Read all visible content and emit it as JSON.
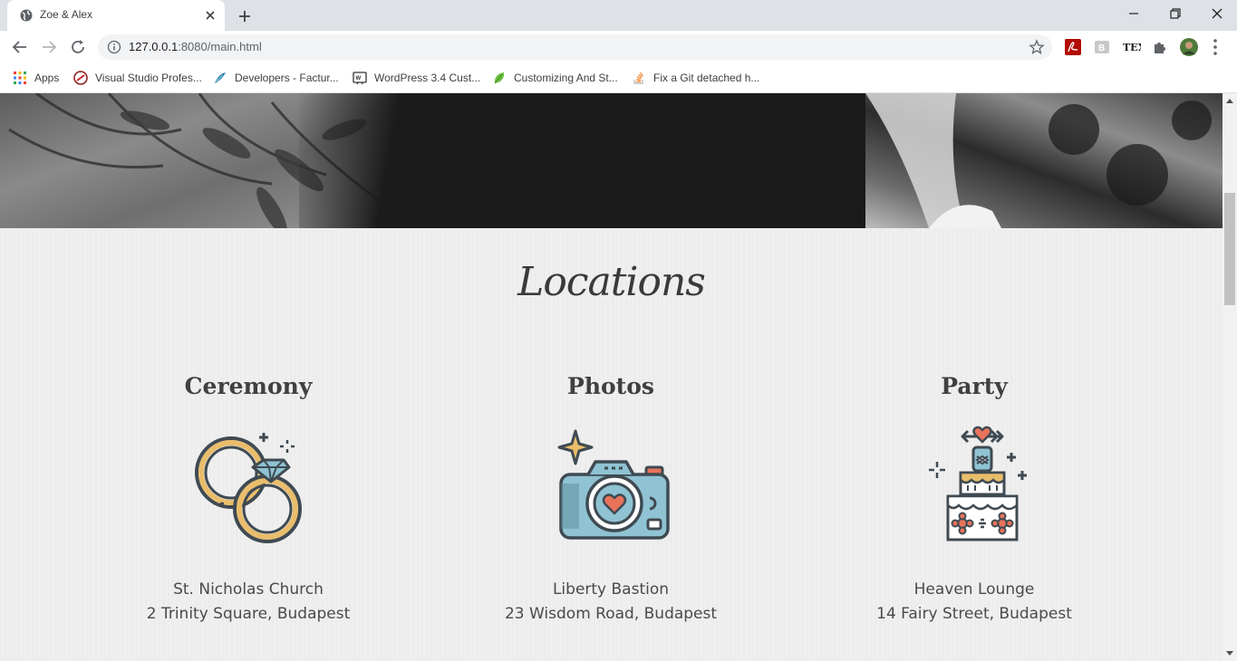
{
  "browser": {
    "tab_title": "Zoe & Alex",
    "url_host": "127.0.0.1",
    "url_rest": ":8080/main.html",
    "bookmarks": [
      {
        "label": "Apps",
        "icon": "apps-grid-icon"
      },
      {
        "label": "Visual Studio Profes...",
        "icon": "visual-studio-icon"
      },
      {
        "label": "Developers - Factur...",
        "icon": "feather-icon"
      },
      {
        "label": "WordPress 3.4 Cust...",
        "icon": "wordpress-icon"
      },
      {
        "label": "Customizing And St...",
        "icon": "leaf-icon"
      },
      {
        "label": "Fix a Git detached h...",
        "icon": "stackoverflow-icon"
      }
    ]
  },
  "page": {
    "section_title": "Locations",
    "locations": [
      {
        "title": "Ceremony",
        "place": "St. Nicholas Church",
        "address": "2 Trinity Square, Budapest",
        "icon": "wedding-rings-icon"
      },
      {
        "title": "Photos",
        "place": "Liberty Bastion",
        "address": "23 Wisdom Road, Budapest",
        "icon": "camera-icon"
      },
      {
        "title": "Party",
        "place": "Heaven Lounge",
        "address": "14 Fairy Street, Budapest",
        "icon": "wedding-cake-icon"
      }
    ]
  },
  "colors": {
    "gold": "#e9bd6b",
    "ink": "#3f4a52",
    "sky": "#8fc3d3",
    "coral": "#e8735a",
    "page_bg": "#efefef",
    "heading": "#404040"
  }
}
